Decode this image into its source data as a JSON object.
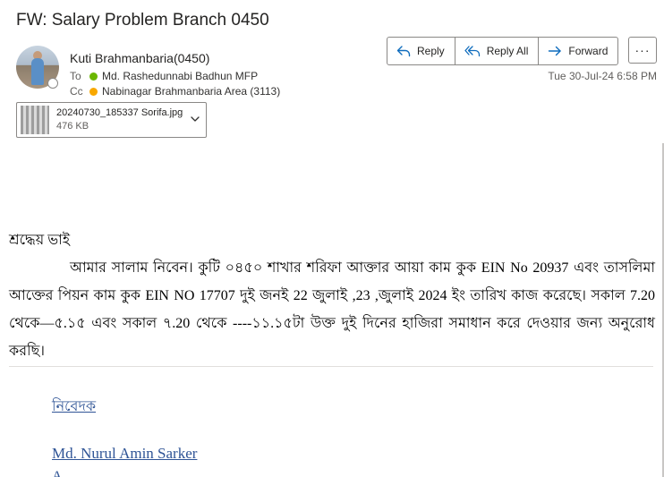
{
  "email": {
    "subject": "FW: Salary Problem Branch 0450",
    "sender": "Kuti Brahmanbaria(0450)",
    "to_label": "To",
    "to": "Md. Rashedunnabi Badhun MFP",
    "cc_label": "Cc",
    "cc": "Nabinagar Brahmanbaria Area (3113)",
    "timestamp": "Tue 30-Jul-24 6:58 PM"
  },
  "actions": {
    "reply": "Reply",
    "reply_all": "Reply All",
    "forward": "Forward",
    "more": "···"
  },
  "attachment": {
    "name": "20240730_185337 Sorifa.jpg",
    "size": "476 KB"
  },
  "body": {
    "greeting": "শ্রদ্ধেয় ভাই",
    "paragraph": "আমার সালাম নিবেন। কুটি ০৪৫০ শাখার শরিফা আক্তার আয়া কাম কুক EIN No 20937 এবং তাসলিমা আক্তের পিয়ন কাম কুক EIN NO 17707 দুই জনই 22 জুলাই ,23 ,জুলাই 2024 ইং তারিখ কাজ করেছে। সকাল 7.20 থেকে—৫.১৫ এবং সকাল ৭.20 থেকে ----১১.১৫টা উক্ত দুই দিনের হাজিরা সমাধান করে দেওয়ার জন্য অনুরোধ করছি।",
    "signature_label": "নিবেদক",
    "signature_name": "Md. Nurul Amin Sarker",
    "signature_next": "A"
  },
  "colors": {
    "accent": "#0f6cbd",
    "presence_green": "#6bb700",
    "presence_yellow": "#f8a800",
    "signature_blue": "#2f5496"
  },
  "icons": {
    "reply": "reply-arrow-icon",
    "reply_all": "reply-all-icon",
    "forward": "forward-arrow-icon",
    "attachment_menu": "chevron-down-icon"
  }
}
